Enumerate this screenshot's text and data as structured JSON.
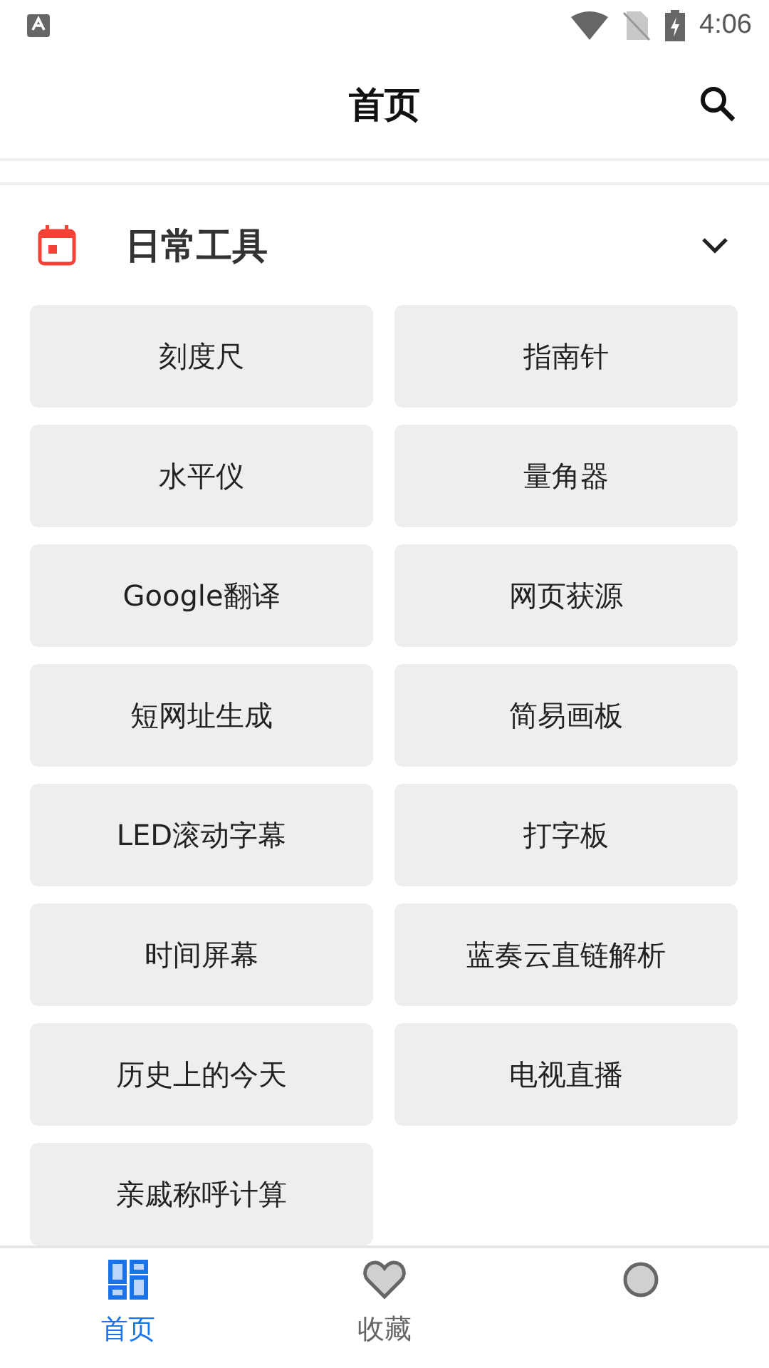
{
  "status_bar": {
    "time": "4:06"
  },
  "app_bar": {
    "title": "首页"
  },
  "section": {
    "title": "日常工具",
    "expanded": true
  },
  "tools": [
    {
      "label": "刻度尺"
    },
    {
      "label": "指南针"
    },
    {
      "label": "水平仪"
    },
    {
      "label": "量角器"
    },
    {
      "label": "Google翻译"
    },
    {
      "label": "网页获源"
    },
    {
      "label": "短网址生成"
    },
    {
      "label": "简易画板"
    },
    {
      "label": "LED滚动字幕"
    },
    {
      "label": "打字板"
    },
    {
      "label": "时间屏幕"
    },
    {
      "label": "蓝奏云直链解析"
    },
    {
      "label": "历史上的今天"
    },
    {
      "label": "电视直播"
    },
    {
      "label": "亲戚称呼计算"
    }
  ],
  "bottom_nav": [
    {
      "kind": "home",
      "label": "首页",
      "selected": true
    },
    {
      "kind": "favorites",
      "label": "收藏",
      "selected": false
    },
    {
      "kind": "other",
      "selected": false
    }
  ]
}
